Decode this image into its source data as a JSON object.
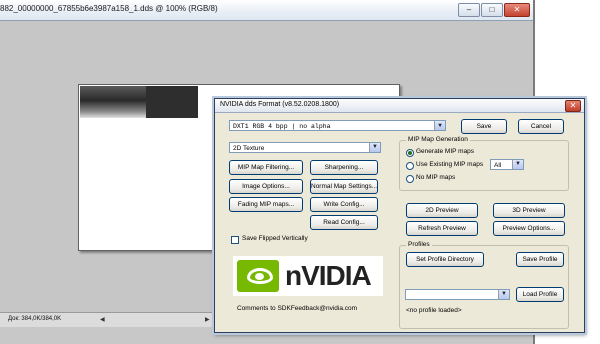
{
  "bg_window": {
    "title": "882_00000000_67855b6e3987a158_1.dds @ 100% (RGB/8)",
    "minimize": "–",
    "maximize": "□",
    "close": "✕",
    "status": "Док: 384,0K/384,0K",
    "nav_left": "◀",
    "nav_right": "▶"
  },
  "dialog": {
    "title": "NVIDIA dds Format (v8.52.0208.1800)",
    "close": "✕",
    "format_select": "DXT1           RGB    4 bpp | no alpha",
    "save": "Save",
    "cancel": "Cancel",
    "texture_type": "2D Texture",
    "buttons": {
      "mip_filtering": "MIP Map Filtering...",
      "sharpening": "Sharpening...",
      "image_options": "Image Options...",
      "normal_map": "Normal Map Settings...",
      "fading_mip": "Fading MIP maps...",
      "write_config": "Write Config...",
      "read_config": "Read Config...",
      "preview_2d": "2D Preview",
      "preview_3d": "3D Preview",
      "refresh_preview": "Refresh Preview",
      "preview_options": "Preview Options...",
      "set_profile_dir": "Set Profile Directory",
      "save_profile": "Save Profile",
      "load_profile": "Load Profile"
    },
    "mip_group": {
      "label": "MIP Map Generation",
      "options": [
        "Generate MIP maps",
        "Use Existing MIP maps",
        "No MIP maps"
      ],
      "selected": 0,
      "existing_count": "All"
    },
    "save_flipped": "Save Flipped Vertically",
    "profiles": {
      "label": "Profiles",
      "selected": "",
      "status": "<no profile loaded>"
    },
    "logo_text": "nVIDIA",
    "feedback": "Comments to SDKFeedback@nvidia.com"
  },
  "colors": {
    "nvidia_green": "#76b900",
    "dialog_bg": "#ece9d8",
    "canvas_bg": "#c6c6c6"
  }
}
